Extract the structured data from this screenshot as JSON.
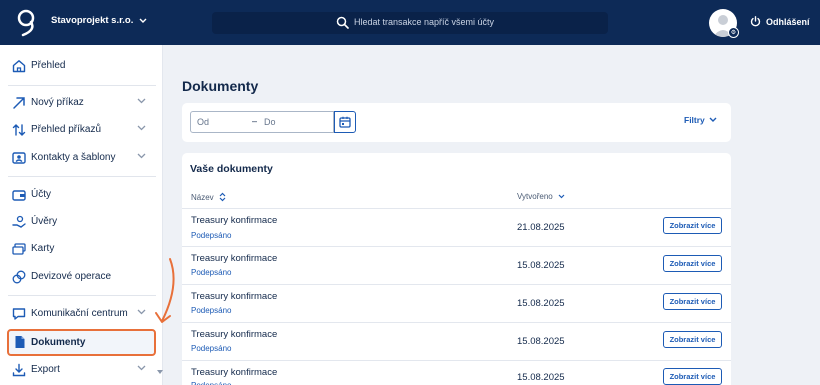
{
  "header": {
    "company": "Stavoprojekt s.r.o.",
    "search_placeholder": "Hledat transakce napříč všemi účty",
    "logout_label": "Odhlášení"
  },
  "sidebar": {
    "items": [
      {
        "label": "Přehled",
        "icon": "home-icon"
      },
      {
        "label": "Nový příkaz",
        "icon": "arrow-up-right-icon",
        "expandable": true
      },
      {
        "label": "Přehled příkazů",
        "icon": "transfer-arrows-icon",
        "expandable": true
      },
      {
        "label": "Kontakty a šablony",
        "icon": "contact-card-icon",
        "expandable": true
      },
      {
        "label": "Účty",
        "icon": "wallet-icon"
      },
      {
        "label": "Úvěry",
        "icon": "loan-hand-icon"
      },
      {
        "label": "Karty",
        "icon": "cards-icon"
      },
      {
        "label": "Devizové operace",
        "icon": "currency-exchange-icon"
      },
      {
        "label": "Komunikační centrum",
        "icon": "chat-bubble-icon",
        "expandable": true
      },
      {
        "label": "Dokumenty",
        "icon": "document-icon",
        "active": true
      },
      {
        "label": "Export",
        "icon": "download-icon",
        "expandable": true
      }
    ]
  },
  "main": {
    "title": "Dokumenty",
    "filter": {
      "from_placeholder": "Od",
      "dash": "–",
      "to_placeholder": "Do",
      "filters_label": "Filtry"
    },
    "documents": {
      "title": "Vaše dokumenty",
      "columns": {
        "name": "Název",
        "created": "Vytvořeno"
      },
      "rows": [
        {
          "name": "Treasury konfirmace",
          "status": "Podepsáno",
          "date": "21.08.2025",
          "action": "Zobrazit více"
        },
        {
          "name": "Treasury konfirmace",
          "status": "Podepsáno",
          "date": "15.08.2025",
          "action": "Zobrazit více"
        },
        {
          "name": "Treasury konfirmace",
          "status": "Podepsáno",
          "date": "15.08.2025",
          "action": "Zobrazit více"
        },
        {
          "name": "Treasury konfirmace",
          "status": "Podepsáno",
          "date": "15.08.2025",
          "action": "Zobrazit více"
        },
        {
          "name": "Treasury konfirmace",
          "status": "Podepsáno",
          "date": "15.08.2025",
          "action": "Zobrazit více"
        }
      ]
    }
  },
  "colors": {
    "header_bg": "#0d2a57",
    "accent": "#1d5bb5",
    "highlight": "#e8703a"
  }
}
